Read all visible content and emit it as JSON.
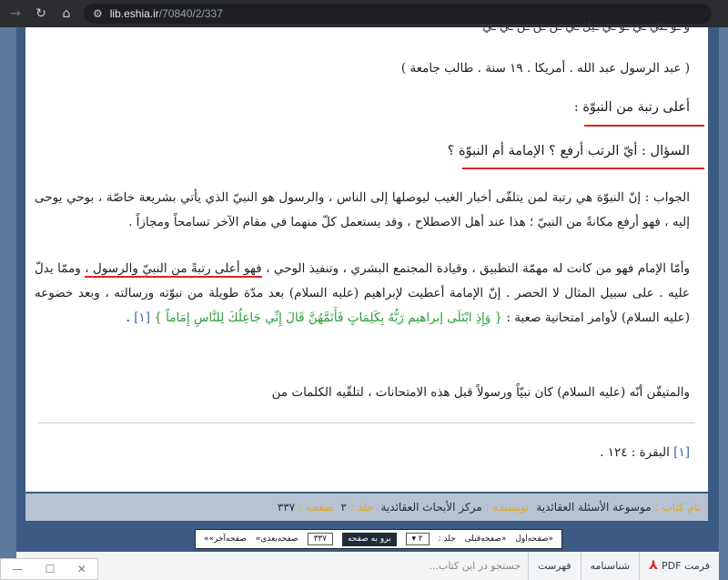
{
  "browser": {
    "url_host": "lib.eshia.ir",
    "url_path": "/70840/2/337"
  },
  "book": {
    "top_fragment": "و ـو ـلي ـي ـو ـي ـيل ـي ـن ـن ـن ـي ـي",
    "attribution": "( عبد الرسول عبد الله . أمريكا . ١٩ سنة . طالب جامعة )",
    "heading1": "أعلى رتبة من النبوّة :",
    "heading2": "السؤال : أيّ الرتب أرفع ؟ الإمامة أم النبوّة ؟",
    "answer": "الجواب : إنّ النبوّة هي رتبة لمن يتلقّى أخبار الغيب ليوصلها إلى الناس ، والرسول هو النبيّ الذي يأتي بشريعة خاصّة ، بوحي يوحى إليه ، فهو أرفع مكانةً من النبيّ ؛ هذا عند أهل الاصطلاح ، وقد يستعمل كلّ منهما في مقام الآخر تسامحاً ومجازاً .",
    "imam_start": "وأمّا الإمام فهو من كانت له مهمّة التطبيق ، وقيادة المجتمع البشري ، وتنفيذ الوحي ،",
    "imam_highlight": "فهو أعلى رتبةً من النبيّ والرسول ،",
    "imam_rest": "وممّا يدلّ عليه . على سبيل المثال لا الحصر . إنّ الإمامة أعطيت لإبراهيم (عليه السلام) بعد مدّة طويلة من نبوّته ورسالته ، وبعد خضوعه (عليه السلام) لأوامر امتحانية صعبة :",
    "quran": "{ وَإِذِ ابْتَلَى إبراهيم رَبُّهُ بِكَلِمَاتٍ فَأَتَمَّهُنَّ قَالَ إِنِّي جَاعِلُكَ لِلنَّاسِ إِمَاماً }",
    "ref_mark": "[١]",
    "imam_end": ".",
    "certain": "والمتيقّن أنّه (عليه السلام) كان نبيّاً ورسولاً قبل هذه الامتحانات ، لتلقّيه الكلمات من",
    "footnote_mark": "[١]",
    "footnote": "البقرة : ١٢٤ ."
  },
  "infobar": {
    "book_label": "نام کتاب :",
    "book_value": "موسوعة الأسئلة العقائدية",
    "author_label": "نویسنده :",
    "author_value": "مركز الأبحاث العقائدية",
    "vol_label": "جلد :",
    "vol_value": "٢",
    "page_label": "صفحه :",
    "page_value": "٣٣٧"
  },
  "pager": {
    "first": "«صفحه‌اول",
    "prev": "«صفحه‌قبلی",
    "vol_label": "جلد :",
    "vol_value": "٢",
    "go_button": "برو به صفحه",
    "page_value": "٣٣٧",
    "next": "صفحه‌بعدى»",
    "last": "صفحه‌آخر»»"
  },
  "tabs": {
    "pdf": "فرمت PDF",
    "shenasname": "شناسنامه",
    "fehrest": "فهرست",
    "search_placeholder": "جستجو در این کتاب..."
  },
  "mini": {
    "minimize": "—",
    "maximize": "☐",
    "close": "✕"
  }
}
